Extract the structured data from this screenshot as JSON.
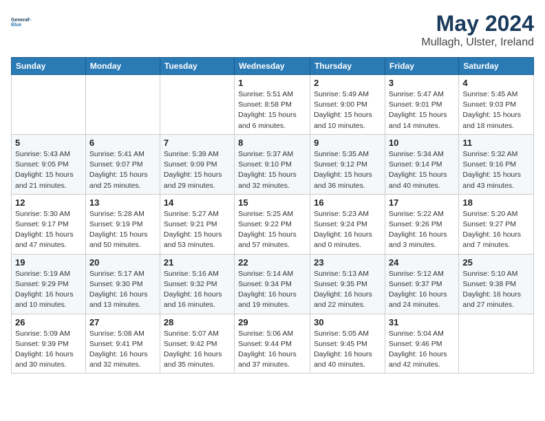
{
  "logo": {
    "line1": "General",
    "line2": "Blue"
  },
  "title": "May 2024",
  "subtitle": "Mullagh, Ulster, Ireland",
  "headers": [
    "Sunday",
    "Monday",
    "Tuesday",
    "Wednesday",
    "Thursday",
    "Friday",
    "Saturday"
  ],
  "weeks": [
    [
      {
        "day": "",
        "info": ""
      },
      {
        "day": "",
        "info": ""
      },
      {
        "day": "",
        "info": ""
      },
      {
        "day": "1",
        "info": "Sunrise: 5:51 AM\nSunset: 8:58 PM\nDaylight: 15 hours\nand 6 minutes."
      },
      {
        "day": "2",
        "info": "Sunrise: 5:49 AM\nSunset: 9:00 PM\nDaylight: 15 hours\nand 10 minutes."
      },
      {
        "day": "3",
        "info": "Sunrise: 5:47 AM\nSunset: 9:01 PM\nDaylight: 15 hours\nand 14 minutes."
      },
      {
        "day": "4",
        "info": "Sunrise: 5:45 AM\nSunset: 9:03 PM\nDaylight: 15 hours\nand 18 minutes."
      }
    ],
    [
      {
        "day": "5",
        "info": "Sunrise: 5:43 AM\nSunset: 9:05 PM\nDaylight: 15 hours\nand 21 minutes."
      },
      {
        "day": "6",
        "info": "Sunrise: 5:41 AM\nSunset: 9:07 PM\nDaylight: 15 hours\nand 25 minutes."
      },
      {
        "day": "7",
        "info": "Sunrise: 5:39 AM\nSunset: 9:09 PM\nDaylight: 15 hours\nand 29 minutes."
      },
      {
        "day": "8",
        "info": "Sunrise: 5:37 AM\nSunset: 9:10 PM\nDaylight: 15 hours\nand 32 minutes."
      },
      {
        "day": "9",
        "info": "Sunrise: 5:35 AM\nSunset: 9:12 PM\nDaylight: 15 hours\nand 36 minutes."
      },
      {
        "day": "10",
        "info": "Sunrise: 5:34 AM\nSunset: 9:14 PM\nDaylight: 15 hours\nand 40 minutes."
      },
      {
        "day": "11",
        "info": "Sunrise: 5:32 AM\nSunset: 9:16 PM\nDaylight: 15 hours\nand 43 minutes."
      }
    ],
    [
      {
        "day": "12",
        "info": "Sunrise: 5:30 AM\nSunset: 9:17 PM\nDaylight: 15 hours\nand 47 minutes."
      },
      {
        "day": "13",
        "info": "Sunrise: 5:28 AM\nSunset: 9:19 PM\nDaylight: 15 hours\nand 50 minutes."
      },
      {
        "day": "14",
        "info": "Sunrise: 5:27 AM\nSunset: 9:21 PM\nDaylight: 15 hours\nand 53 minutes."
      },
      {
        "day": "15",
        "info": "Sunrise: 5:25 AM\nSunset: 9:22 PM\nDaylight: 15 hours\nand 57 minutes."
      },
      {
        "day": "16",
        "info": "Sunrise: 5:23 AM\nSunset: 9:24 PM\nDaylight: 16 hours\nand 0 minutes."
      },
      {
        "day": "17",
        "info": "Sunrise: 5:22 AM\nSunset: 9:26 PM\nDaylight: 16 hours\nand 3 minutes."
      },
      {
        "day": "18",
        "info": "Sunrise: 5:20 AM\nSunset: 9:27 PM\nDaylight: 16 hours\nand 7 minutes."
      }
    ],
    [
      {
        "day": "19",
        "info": "Sunrise: 5:19 AM\nSunset: 9:29 PM\nDaylight: 16 hours\nand 10 minutes."
      },
      {
        "day": "20",
        "info": "Sunrise: 5:17 AM\nSunset: 9:30 PM\nDaylight: 16 hours\nand 13 minutes."
      },
      {
        "day": "21",
        "info": "Sunrise: 5:16 AM\nSunset: 9:32 PM\nDaylight: 16 hours\nand 16 minutes."
      },
      {
        "day": "22",
        "info": "Sunrise: 5:14 AM\nSunset: 9:34 PM\nDaylight: 16 hours\nand 19 minutes."
      },
      {
        "day": "23",
        "info": "Sunrise: 5:13 AM\nSunset: 9:35 PM\nDaylight: 16 hours\nand 22 minutes."
      },
      {
        "day": "24",
        "info": "Sunrise: 5:12 AM\nSunset: 9:37 PM\nDaylight: 16 hours\nand 24 minutes."
      },
      {
        "day": "25",
        "info": "Sunrise: 5:10 AM\nSunset: 9:38 PM\nDaylight: 16 hours\nand 27 minutes."
      }
    ],
    [
      {
        "day": "26",
        "info": "Sunrise: 5:09 AM\nSunset: 9:39 PM\nDaylight: 16 hours\nand 30 minutes."
      },
      {
        "day": "27",
        "info": "Sunrise: 5:08 AM\nSunset: 9:41 PM\nDaylight: 16 hours\nand 32 minutes."
      },
      {
        "day": "28",
        "info": "Sunrise: 5:07 AM\nSunset: 9:42 PM\nDaylight: 16 hours\nand 35 minutes."
      },
      {
        "day": "29",
        "info": "Sunrise: 5:06 AM\nSunset: 9:44 PM\nDaylight: 16 hours\nand 37 minutes."
      },
      {
        "day": "30",
        "info": "Sunrise: 5:05 AM\nSunset: 9:45 PM\nDaylight: 16 hours\nand 40 minutes."
      },
      {
        "day": "31",
        "info": "Sunrise: 5:04 AM\nSunset: 9:46 PM\nDaylight: 16 hours\nand 42 minutes."
      },
      {
        "day": "",
        "info": ""
      }
    ]
  ]
}
